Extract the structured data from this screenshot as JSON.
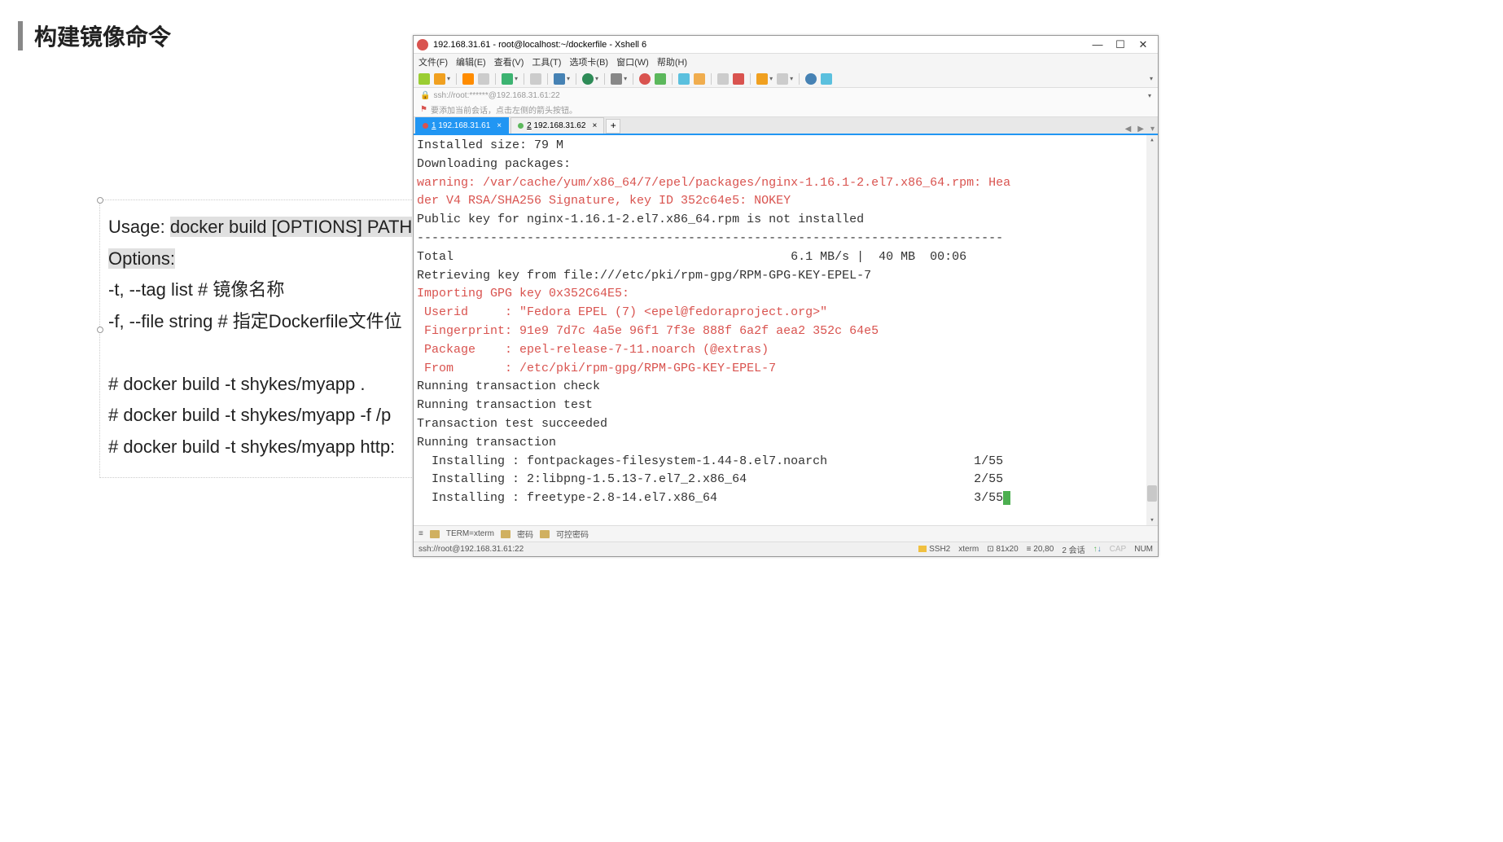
{
  "title": "构建镜像命令",
  "content": {
    "usage_prefix": "Usage: ",
    "usage_sel": "docker build [OPTIONS] PATH",
    "options_label": "Options:",
    "opt1": "-t, --tag list    # 镜像名称",
    "opt2": "-f, --file string  # 指定Dockerfile文件位",
    "ex1": "# docker build -t shykes/myapp .",
    "ex2": "# docker build -t shykes/myapp -f /p",
    "ex3": "# docker build -t shykes/myapp http:"
  },
  "xshell": {
    "title": "192.168.31.61 - root@localhost:~/dockerfile - Xshell 6",
    "menu": [
      "文件(F)",
      "编辑(E)",
      "查看(V)",
      "工具(T)",
      "选项卡(B)",
      "窗口(W)",
      "帮助(H)"
    ],
    "addr": "ssh://root:******@192.168.31.61:22",
    "hint": "要添加当前会话，点击左侧的箭头按钮。",
    "tabs": [
      {
        "num": "1",
        "label": "192.168.31.61"
      },
      {
        "num": "2",
        "label": "192.168.31.62"
      }
    ],
    "terminal": {
      "l1": "Installed size: 79 M",
      "l2": "Downloading packages:",
      "l3": "warning: /var/cache/yum/x86_64/7/epel/packages/nginx-1.16.1-2.el7.x86_64.rpm: Hea",
      "l4": "der V4 RSA/SHA256 Signature, key ID 352c64e5: NOKEY",
      "l5": "Public key for nginx-1.16.1-2.el7.x86_64.rpm is not installed",
      "l6": "--------------------------------------------------------------------------------",
      "l7": "Total                                              6.1 MB/s |  40 MB  00:06     ",
      "l8": "Retrieving key from file:///etc/pki/rpm-gpg/RPM-GPG-KEY-EPEL-7",
      "l9": "Importing GPG key 0x352C64E5:",
      "l10": " Userid     : \"Fedora EPEL (7) <epel@fedoraproject.org>\"",
      "l11": " Fingerprint: 91e9 7d7c 4a5e 96f1 7f3e 888f 6a2f aea2 352c 64e5",
      "l12": " Package    : epel-release-7-11.noarch (@extras)",
      "l13": " From       : /etc/pki/rpm-gpg/RPM-GPG-KEY-EPEL-7",
      "l14": "Running transaction check",
      "l15": "Running transaction test",
      "l16": "Transaction test succeeded",
      "l17": "Running transaction",
      "l18": "  Installing : fontpackages-filesystem-1.44-8.el7.noarch                    1/55",
      "l19": "  Installing : 2:libpng-1.5.13-7.el7_2.x86_64                               2/55",
      "l20": "  Installing : freetype-2.8-14.el7.x86_64                                   3/55"
    },
    "bottom": {
      "term": "TERM=xterm",
      "b1": "密码",
      "b2": "可控密码"
    },
    "status": {
      "left": "ssh://root@192.168.31.61:22",
      "ssh": "SSH2",
      "term": "xterm",
      "size": "81x20",
      "pos": "20,80",
      "sess": "2 会话",
      "cap": "CAP",
      "num": "NUM"
    }
  }
}
